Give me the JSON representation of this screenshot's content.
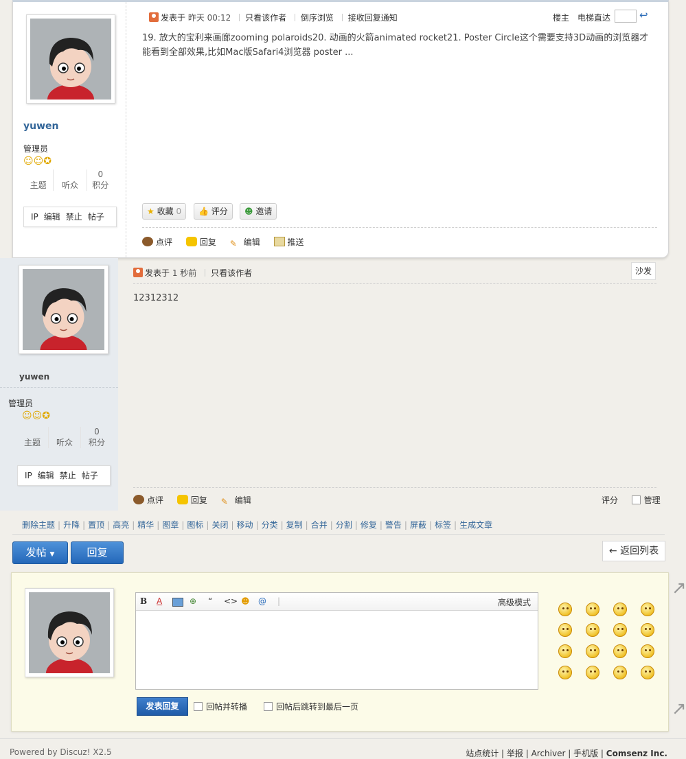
{
  "post1": {
    "username": "yuwen",
    "role": "管理员",
    "stats": [
      {
        "value": "",
        "label": "主题"
      },
      {
        "value": "",
        "label": "听众"
      },
      {
        "value": "0",
        "label": "积分"
      }
    ],
    "admin_links": [
      "IP",
      "编辑",
      "禁止",
      "帖子"
    ],
    "posted_prefix": "发表于",
    "posted_time": "昨天 00:12",
    "meta_links": [
      "只看该作者",
      "倒序浏览",
      "接收回复通知"
    ],
    "floor_label": "楼主",
    "jump_label": "电梯直达",
    "content": "19. 放大的宝利来画廊zooming polaroids20. 动画的火箭animated rocket21. Poster Circle这个需要支持3D动画的浏览器才能看到全部效果,比如Mac版Safari4浏览器 poster ...",
    "favorite_label": "收藏",
    "favorite_count": "0",
    "rate_label": "评分",
    "invite_label": "邀请",
    "actions": [
      "点评",
      "回复",
      "编辑",
      "推送"
    ]
  },
  "post2": {
    "username": "yuwen",
    "role": "管理员",
    "stats": [
      {
        "value": "",
        "label": "主题"
      },
      {
        "value": "",
        "label": "听众"
      },
      {
        "value": "0",
        "label": "积分"
      }
    ],
    "admin_links": [
      "IP",
      "编辑",
      "禁止",
      "帖子"
    ],
    "posted_prefix": "发表于",
    "posted_time": "1 秒前",
    "meta_links": [
      "只看该作者"
    ],
    "floor_label": "沙发",
    "content": "12312312",
    "actions": [
      "点评",
      "回复",
      "编辑"
    ],
    "rate_label": "评分",
    "manage_label": "管理"
  },
  "modbar": [
    "删除主题",
    "升降",
    "置顶",
    "高亮",
    "精华",
    "图章",
    "图标",
    "关闭",
    "移动",
    "分类",
    "复制",
    "合并",
    "分割",
    "修复",
    "警告",
    "屏蔽",
    "标签",
    "生成文章"
  ],
  "buttons": {
    "new_post": "发帖",
    "reply": "回复",
    "back": "返回列表"
  },
  "reply_box": {
    "advanced_mode": "高级模式",
    "submit": "发表回复",
    "option1": "回帖并转播",
    "option2": "回帖后跳转到最后一页"
  },
  "footer": {
    "left": "Powered by Discuz! X2.5",
    "right": [
      "站点统计",
      "举报",
      "Archiver",
      "手机版",
      "Comsenz Inc."
    ]
  },
  "colors": {
    "link_blue": "#336699",
    "button_blue": "#2468b9",
    "reply_bg": "#fcfbe8",
    "sidebar_bg": "#e7ebef"
  }
}
